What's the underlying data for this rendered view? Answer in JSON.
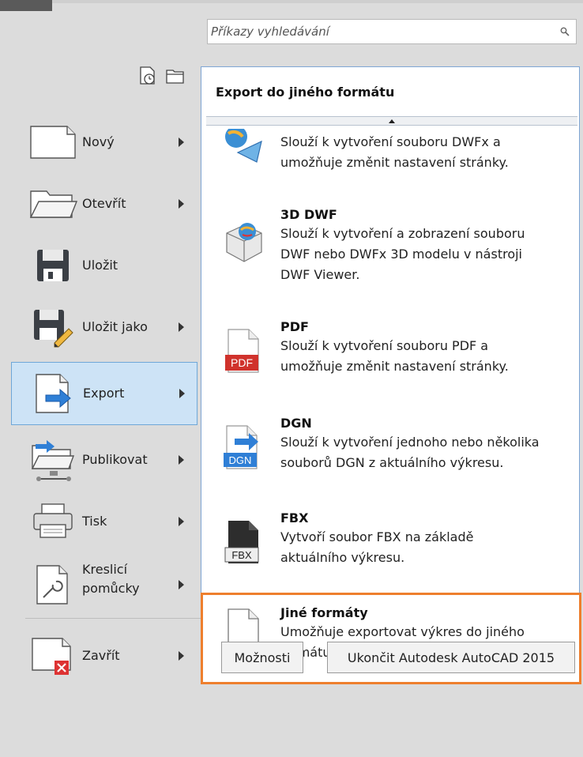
{
  "search": {
    "placeholder": "Příkazy vyhledávání"
  },
  "left_menu": {
    "items": [
      {
        "label": "Nový",
        "has_submenu": true,
        "icon": "new-document-icon"
      },
      {
        "label": "Otevřít",
        "has_submenu": true,
        "icon": "open-folder-icon"
      },
      {
        "label": "Uložit",
        "has_submenu": false,
        "icon": "save-disk-icon"
      },
      {
        "label": "Uložit jako",
        "has_submenu": true,
        "icon": "save-as-icon"
      },
      {
        "label": "Export",
        "has_submenu": true,
        "icon": "export-icon",
        "selected": true
      },
      {
        "label": "Publikovat",
        "has_submenu": true,
        "icon": "publish-icon"
      },
      {
        "label": "Tisk",
        "has_submenu": true,
        "icon": "print-icon"
      },
      {
        "label": "Kreslicí pomůcky",
        "label_line1": "Kreslicí",
        "label_line2": "pomůcky",
        "has_submenu": true,
        "icon": "drawing-utilities-icon"
      },
      {
        "label": "Zavřít",
        "has_submenu": true,
        "icon": "close-document-icon"
      }
    ]
  },
  "export_panel": {
    "title": "Export do jiného formátu",
    "items": [
      {
        "name": "",
        "desc_line1": "Slouží k vytvoření souboru DWFx a",
        "desc_line2": "umožňuje změnit nastavení stránky.",
        "icon": "dwfx-icon"
      },
      {
        "name": "3D DWF",
        "desc_line1": "Slouží k vytvoření a zobrazení souboru",
        "desc_line2": "DWF nebo DWFx 3D modelu v nástroji",
        "desc_line3": "DWF Viewer.",
        "icon": "3d-dwf-icon"
      },
      {
        "name": "PDF",
        "desc_line1": "Slouží k vytvoření souboru PDF a",
        "desc_line2": "umožňuje změnit nastavení stránky.",
        "icon": "pdf-icon",
        "icon_label": "PDF"
      },
      {
        "name": "DGN",
        "desc_line1": "Slouží k vytvoření jednoho nebo několika",
        "desc_line2": "souborů DGN z aktuálního výkresu.",
        "icon": "dgn-icon",
        "icon_label": "DGN"
      },
      {
        "name": "FBX",
        "desc_line1": "Vytvoří soubor FBX na základě",
        "desc_line2": "aktuálního výkresu.",
        "icon": "fbx-icon",
        "icon_label": "FBX"
      },
      {
        "name": "Jiné formáty",
        "desc_line1": "Umožňuje exportovat výkres do jiného",
        "desc_line2": "formátu souboru.",
        "icon": "other-formats-icon",
        "highlighted": true
      }
    ]
  },
  "buttons": {
    "options": "Možnosti",
    "exit": "Ukončit Autodesk AutoCAD 2015"
  },
  "colors": {
    "selected_bg": "#cde3f6",
    "selected_border": "#6ea7d8",
    "highlight": "#ee7f2d",
    "panel_border": "#7ea5d4",
    "pdf_red": "#d0322c",
    "export_arrow_blue": "#2f7fd6"
  }
}
